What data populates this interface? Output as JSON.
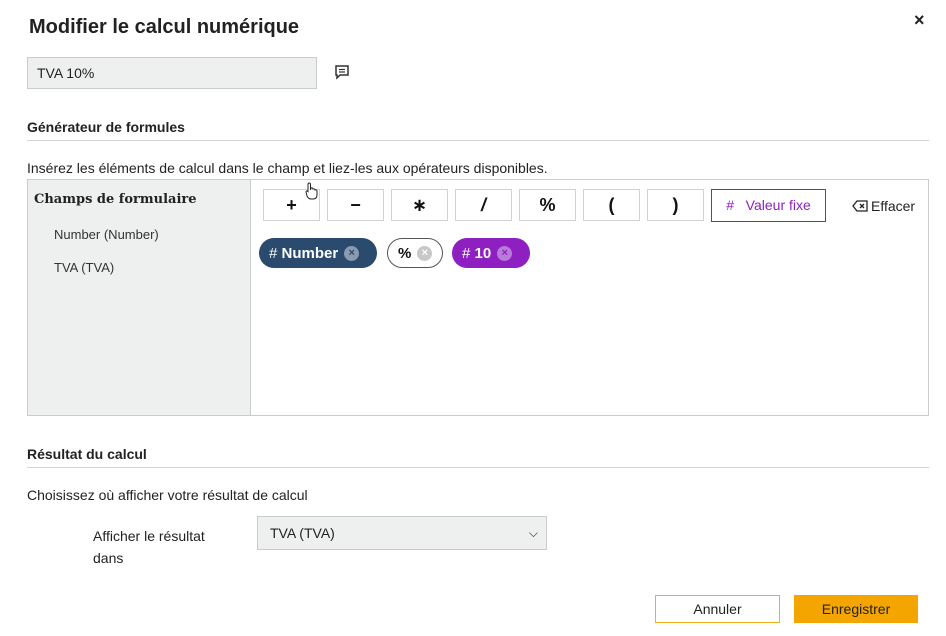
{
  "dialog": {
    "title": "Modifier le calcul numérique",
    "close_label": "×",
    "close_icon": "close-icon",
    "comment_icon": "comment-icon"
  },
  "name_field": {
    "value": "TVA 10%"
  },
  "formula": {
    "section_title": "Générateur de formules",
    "instruction": "Insérez les éléments de calcul dans le champ et liez-les aux opérateurs disponibles.",
    "fields_title": "Champs de formulaire",
    "fields": [
      "Number (Number)",
      "TVA (TVA)"
    ],
    "operators": [
      "+",
      "−",
      "∗",
      "/",
      "%",
      "(",
      ")"
    ],
    "fixed_value_icon": "#",
    "fixed_value_label": "Valeur fixe",
    "clear_label": "Effacer",
    "tokens": [
      {
        "prefix": "#",
        "label": "Number",
        "type": "field"
      },
      {
        "prefix": "",
        "label": "%",
        "type": "operator"
      },
      {
        "prefix": "#",
        "label": "10",
        "type": "fixed"
      }
    ],
    "colors": {
      "field": "#2a4a6e",
      "fixed": "#8e1fc0"
    }
  },
  "result": {
    "section_title": "Résultat du calcul",
    "instruction": "Choisissez où afficher votre résultat de calcul",
    "display_label_line1": "Afficher le résultat",
    "display_label_line2": "dans",
    "selected": "TVA (TVA)"
  },
  "actions": {
    "cancel": "Annuler",
    "save": "Enregistrer",
    "accent": "#f5a500"
  }
}
